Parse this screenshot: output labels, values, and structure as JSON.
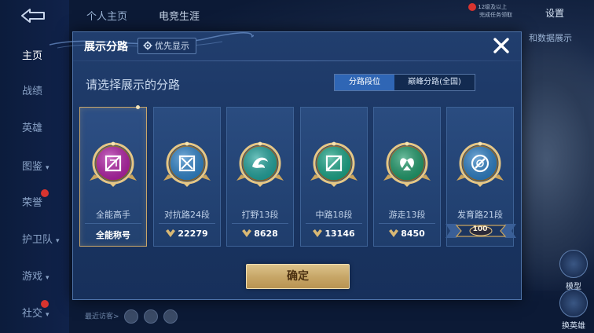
{
  "sidebar": {
    "items": [
      {
        "label": "主页",
        "active": true
      },
      {
        "label": "战绩",
        "active": false
      },
      {
        "label": "英雄",
        "active": false
      },
      {
        "label": "图鉴",
        "active": false,
        "has_arrow": true
      },
      {
        "label": "荣誉",
        "active": false,
        "badge": true
      },
      {
        "label": "护卫队",
        "active": false,
        "has_arrow": true
      },
      {
        "label": "游戏",
        "active": false,
        "has_arrow": true
      },
      {
        "label": "社交",
        "active": false,
        "has_arrow": true,
        "badge": true
      }
    ]
  },
  "topbar": {
    "tab_profile": "个人主页",
    "tab_second": "电竞生涯",
    "settings_label": "设置",
    "notif_line1": "12级及以上",
    "notif_line2": "完成任务领取"
  },
  "background": {
    "data_display_label": "和数据展示",
    "visitors_label": "最近访客>",
    "right_btn_model": "模型",
    "right_btn_swap": "换英雄"
  },
  "modal": {
    "title": "展示分路",
    "priority_label": "优先显示",
    "prompt": "请选择展示的分路",
    "toggle": {
      "options": [
        "分路段位",
        "巅峰分路(全国)"
      ],
      "active_index": 0
    },
    "cards": [
      {
        "label": "全能高手",
        "stat": "全能称号",
        "emblem_color": "#b21fa6",
        "icon": "all-round",
        "selected": true,
        "stat_type": "text"
      },
      {
        "label": "对抗路24段",
        "stat": "22279",
        "emblem_color": "#2d82c9",
        "icon": "clash-lane",
        "selected": false,
        "stat_type": "points"
      },
      {
        "label": "打野13段",
        "stat": "8628",
        "emblem_color": "#1fa29b",
        "icon": "jungle",
        "selected": false,
        "stat_type": "points"
      },
      {
        "label": "中路18段",
        "stat": "13146",
        "emblem_color": "#17a486",
        "icon": "mid-lane",
        "selected": false,
        "stat_type": "points"
      },
      {
        "label": "游走13段",
        "stat": "8450",
        "emblem_color": "#1e9a6a",
        "icon": "roam",
        "selected": false,
        "stat_type": "points"
      },
      {
        "label": "发育路21段",
        "stat": "100",
        "emblem_color": "#2a7dc4",
        "icon": "farm-lane",
        "selected": false,
        "stat_type": "banner"
      }
    ],
    "confirm_label": "确定"
  },
  "colors": {
    "accent_gold": "#c8a66a",
    "modal_bg": "#1b3663",
    "toggle_active": "#2f66b5",
    "badge_red": "#d8342f"
  }
}
